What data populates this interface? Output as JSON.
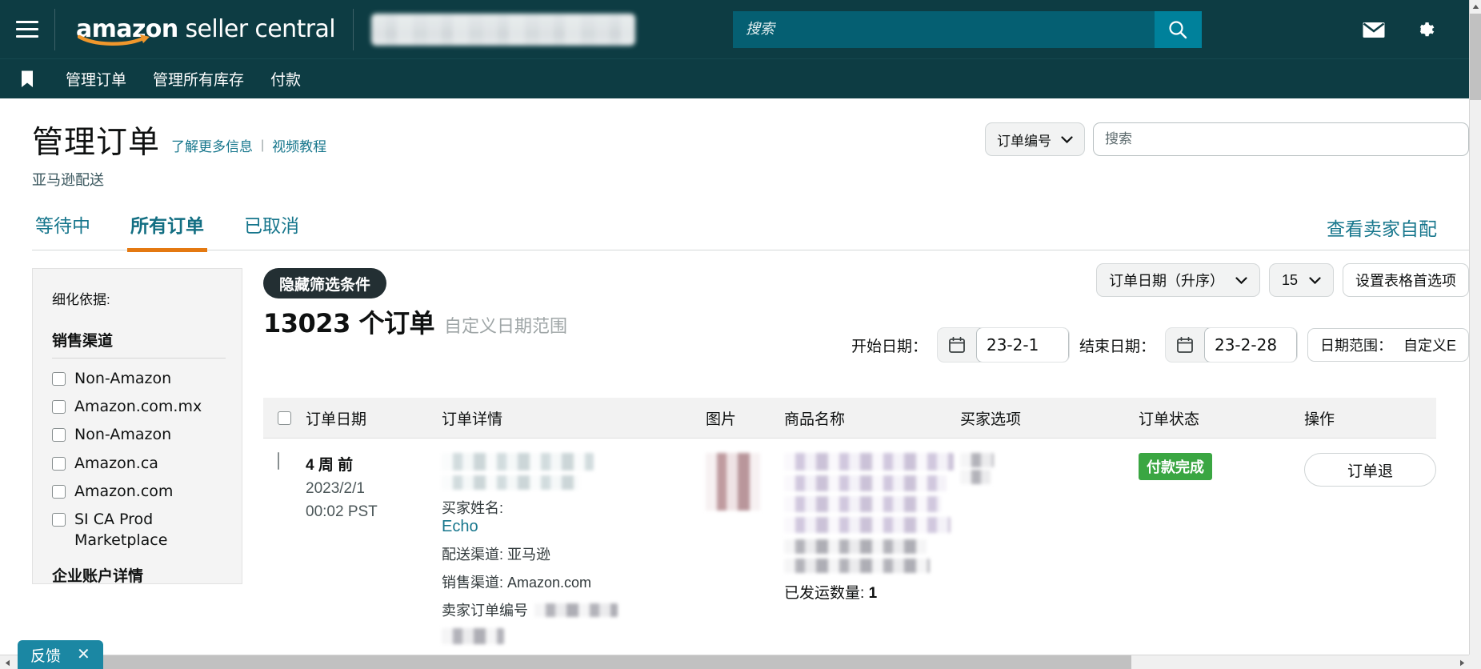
{
  "topbar": {
    "menu_icon": "hamburger-icon",
    "brand_bold": "amazon",
    "brand_light": " seller central",
    "search_placeholder": "搜索",
    "search_icon": "search-icon",
    "mail_icon": "mail-icon",
    "settings_icon": "gear-icon",
    "accent_teal": "#00819b",
    "bar_bg": "#0d3c43"
  },
  "subnav": {
    "bookmark_icon": "bookmark-icon",
    "items": [
      {
        "label": "管理订单"
      },
      {
        "label": "管理所有库存"
      },
      {
        "label": "付款"
      }
    ]
  },
  "header": {
    "title": "管理订单",
    "links": [
      {
        "label": "了解更多信息"
      },
      {
        "label": "视频教程"
      }
    ],
    "separator": "|",
    "subtitle": "亚马逊配送",
    "order_filter_label": "订单编号",
    "chevron_icon": "chevron-down-icon",
    "search_placeholder": "搜索"
  },
  "tabs": {
    "items": [
      {
        "label": "等待中",
        "active": false
      },
      {
        "label": "所有订单",
        "active": true
      },
      {
        "label": "已取消",
        "active": false
      }
    ],
    "right_link": "查看卖家自配",
    "active_underline_color": "#e47911"
  },
  "sidebar": {
    "refine_label": "细化依据:",
    "group_title": "销售渠道",
    "options": [
      {
        "label": "Non-Amazon",
        "checked": false
      },
      {
        "label": "Amazon.com.mx",
        "checked": false
      },
      {
        "label": "Non-Amazon",
        "checked": false
      },
      {
        "label": "Amazon.ca",
        "checked": false
      },
      {
        "label": "Amazon.com",
        "checked": false
      },
      {
        "label": "SI CA Prod Marketplace",
        "checked": false
      }
    ],
    "group_title_2": "企业账户详情"
  },
  "main": {
    "hide_filters_label": "隐藏筛选条件",
    "order_count": "13023 个订单",
    "date_range_label": "自定义日期范围",
    "sort_label": "订单日期（升序）",
    "page_size": "15",
    "table_prefs_label": "设置表格首选项",
    "start_date_label": "开始日期：",
    "start_date_value": "23-2-1",
    "end_date_label": "结束日期：",
    "end_date_value": "23-2-28",
    "date_range_selector_label": "日期范围：",
    "date_range_selector_value": "自定义E",
    "calendar_icon": "calendar-icon"
  },
  "table": {
    "columns": [
      {
        "label": "订单日期"
      },
      {
        "label": "订单详情"
      },
      {
        "label": "图片"
      },
      {
        "label": "商品名称"
      },
      {
        "label": "买家选项"
      },
      {
        "label": "订单状态"
      },
      {
        "label": "操作"
      }
    ],
    "rows": [
      {
        "relative_date": "4 周 前",
        "date": "2023/2/1",
        "time": "00:02 PST",
        "buyer_label": "买家姓名:",
        "buyer_link": "Echo",
        "fulfillment": "配送渠道: 亚马逊",
        "sales_channel": "销售渠道: Amazon.com",
        "seller_order_label": "卖家订单编号",
        "shipped_qty_label": "已发运数量:",
        "shipped_qty_value": "1",
        "status": "付款完成",
        "status_color": "#3aa642",
        "action_label": "订单退"
      }
    ]
  },
  "feedback": {
    "label": "反馈",
    "close_icon": "close-icon",
    "bg_color": "#1b87a3"
  },
  "scrollbars": {
    "vertical_up_icon": "caret-up-icon",
    "horizontal_left_icon": "caret-left-icon",
    "horizontal_right_icon": "caret-right-icon"
  }
}
